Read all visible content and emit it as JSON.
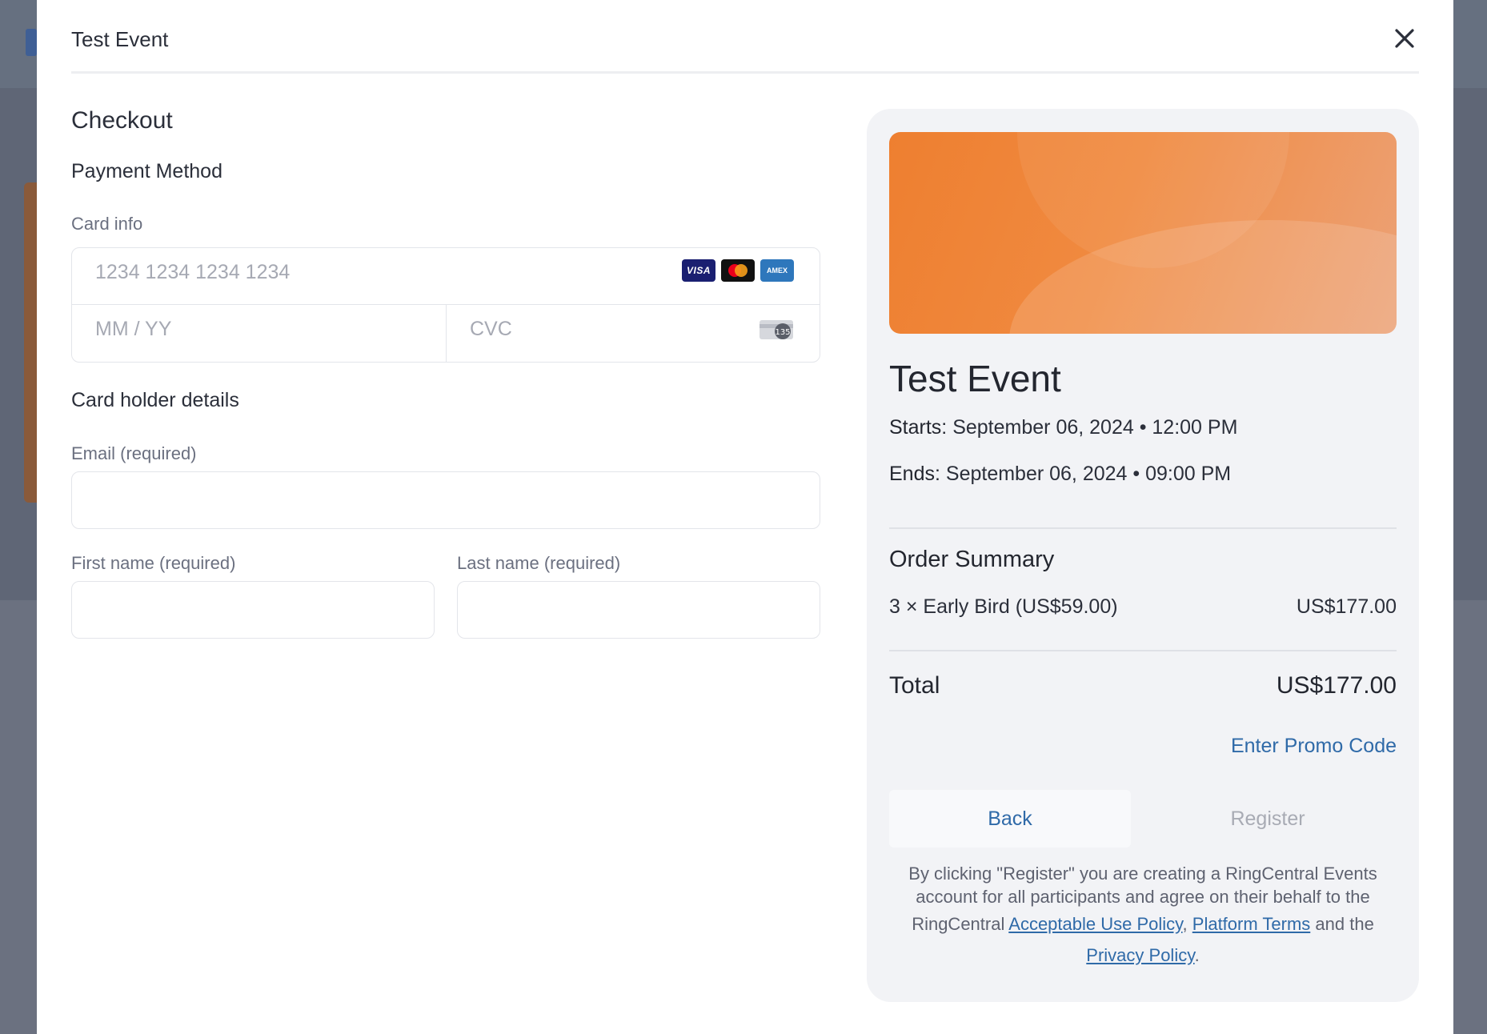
{
  "modal": {
    "title": "Test Event"
  },
  "checkout": {
    "heading": "Checkout",
    "payment_method_heading": "Payment Method",
    "card_info_label": "Card info",
    "card_number_placeholder": "1234 1234 1234 1234",
    "expiry_placeholder": "MM / YY",
    "cvc_placeholder": "CVC",
    "card_brands": [
      "VISA",
      "Mastercard",
      "AMEX"
    ],
    "cvc_icon_text": "135",
    "cardholder_heading": "Card holder details",
    "email_label": "Email",
    "email_required": "(required)",
    "first_name_label": "First name",
    "first_name_required": "(required)",
    "last_name_label": "Last name",
    "last_name_required": "(required)"
  },
  "event": {
    "title": "Test Event",
    "starts_label": "Starts:",
    "starts_value": "September 06, 2024 • 12:00 PM",
    "ends_label": "Ends:",
    "ends_value": "September 06, 2024 • 09:00 PM"
  },
  "order": {
    "heading": "Order Summary",
    "item_label": "3 × Early Bird (US$59.00)",
    "item_price": "US$177.00",
    "total_label": "Total",
    "total_value": "US$177.00",
    "promo_link": "Enter Promo Code"
  },
  "actions": {
    "back_label": "Back",
    "register_label": "Register"
  },
  "legal": {
    "line1": "By clicking \"Register\" you are creating a RingCentral Events account for all participants and agree on their behalf to the",
    "prefix2": "RingCentral",
    "aup_link": "Acceptable Use Policy",
    "comma": ",",
    "terms_link": "Platform Terms",
    "and_the": "and the",
    "privacy_link": "Privacy Policy",
    "period": "."
  },
  "colors": {
    "accent": "#2f6aa8",
    "banner_start": "#ee7f30",
    "banner_end": "#eca277",
    "panel_bg": "#f2f3f6"
  }
}
